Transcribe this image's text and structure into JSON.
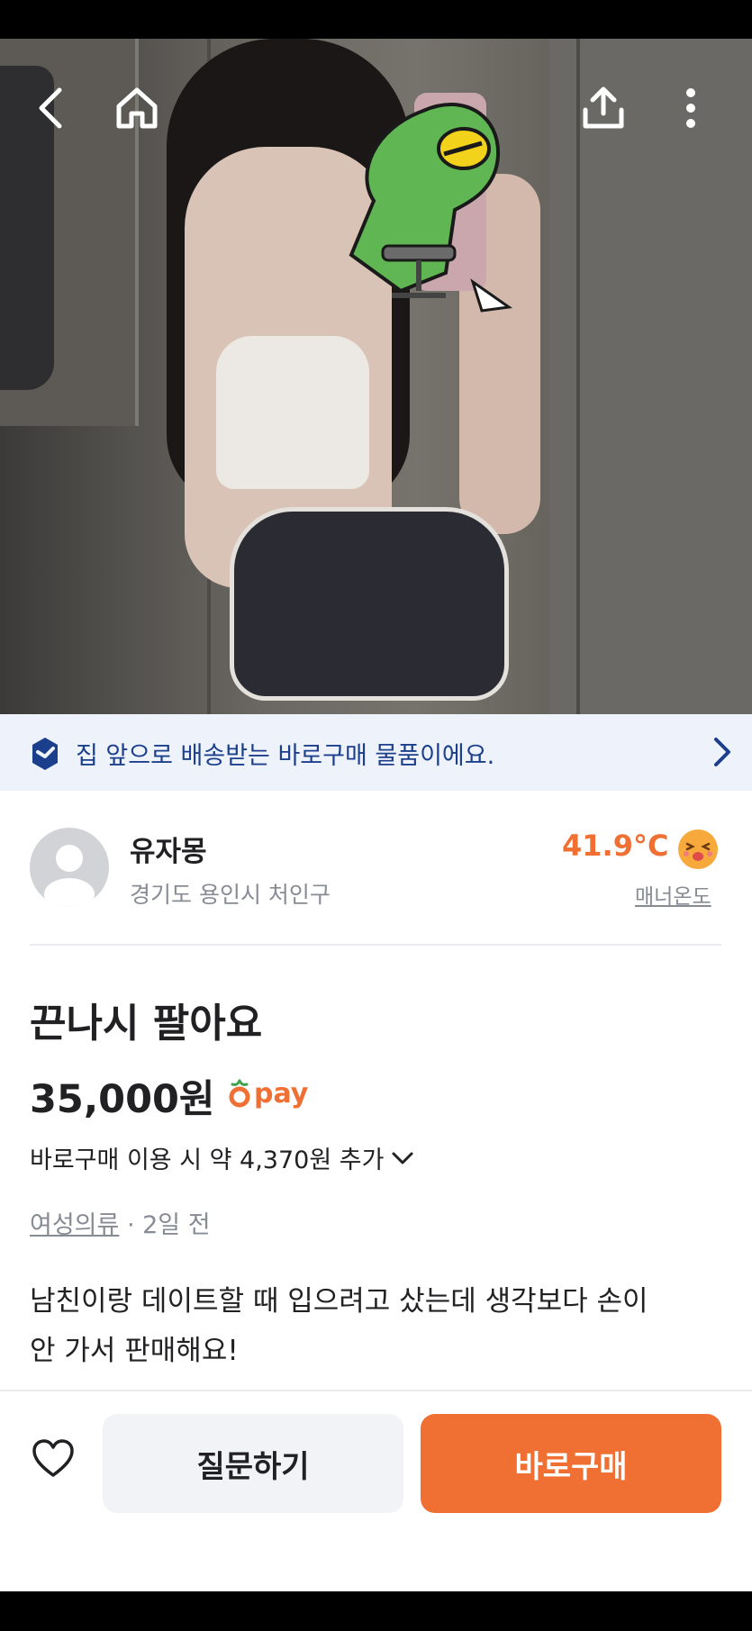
{
  "colors": {
    "accent": "#f06f33",
    "banner_bg": "#eef3fb",
    "banner_text": "#1c3f8c",
    "text_primary": "#212124",
    "text_secondary": "#868b94"
  },
  "header": {
    "icons": [
      "back-arrow-icon",
      "home-icon",
      "share-icon",
      "more-vertical-icon"
    ]
  },
  "banner": {
    "text": "집 앞으로 배송받는 바로구매 물품이에요.",
    "icon": "box-delivery-icon"
  },
  "seller": {
    "name": "유자몽",
    "location": "경기도 용인시 처인구",
    "temperature": "41.9°C",
    "manner_label": "매너온도"
  },
  "product": {
    "title": "끈나시 팔아요",
    "price": "35,000원",
    "pay_label": "pay",
    "direct_buy_extra": "바로구매 이용 시 약 4,370원 추가",
    "category": "여성의류",
    "time_ago": "· 2일 전",
    "description_line1": "남친이랑 데이트할 때 입으려고 샀는데 생각보다 손이",
    "description_line2": "안 가서 판매해요!"
  },
  "footer": {
    "ask_label": "질문하기",
    "buy_label": "바로구매"
  }
}
